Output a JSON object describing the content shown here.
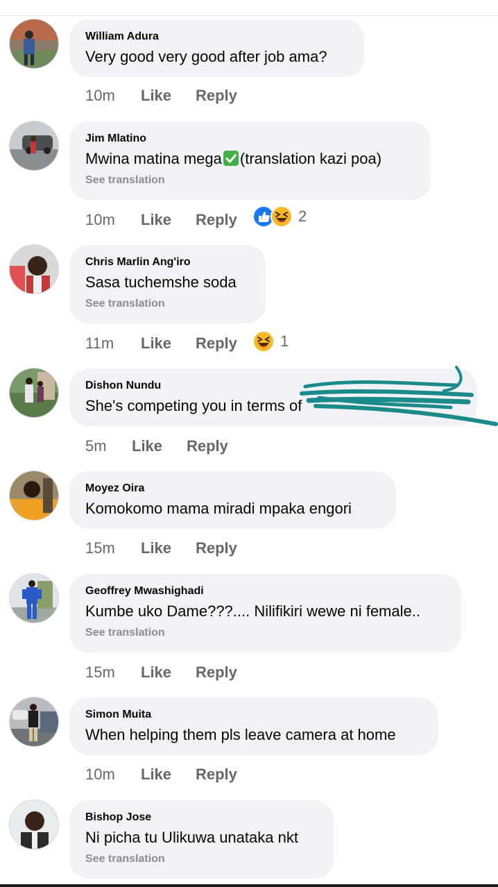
{
  "actions": {
    "like_label": "Like",
    "reply_label": "Reply"
  },
  "see_translation_label": "See translation",
  "comments": [
    {
      "name": "William Adura",
      "text": "Very good very good after job ama?",
      "time": "10m"
    },
    {
      "name": "Jim Mlatino",
      "text_before": "Mwina matina mega",
      "text_icon": "check-mark-emoji",
      "text_after": "(translation kazi poa)",
      "time": "10m",
      "reaction_count": "2",
      "reaction_icons": [
        "like-reaction-icon",
        "haha-reaction-icon"
      ]
    },
    {
      "name": "Chris Marlin Ang'iro",
      "text": "Sasa tuchemshe soda",
      "time": "11m",
      "reaction_count": "1",
      "reaction_icons": [
        "haha-reaction-icon"
      ]
    },
    {
      "name": "Dishon Nundu",
      "text": "She's competing you  in terms of",
      "redaction_color": "#1a8a8a",
      "time": "5m"
    },
    {
      "name": "Moyez Oira",
      "text": "Komokomo mama miradi mpaka engori",
      "time": "15m"
    },
    {
      "name": "Geoffrey Mwashighadi",
      "text": "Kumbe uko Dame???.... Nilifikiri wewe ni female..",
      "time": "15m"
    },
    {
      "name": "Simon Muita",
      "text": "When helping them pls leave camera at home",
      "time": "10m"
    },
    {
      "name": "Bishop Jose",
      "text": "Ni picha tu Ulikuwa unataka nkt",
      "time": ""
    }
  ],
  "colors": {
    "bubble": "#f0f2f5",
    "meta": "#65676b",
    "like_blue": "#1877f2",
    "haha_yellow": "#f7b928"
  }
}
